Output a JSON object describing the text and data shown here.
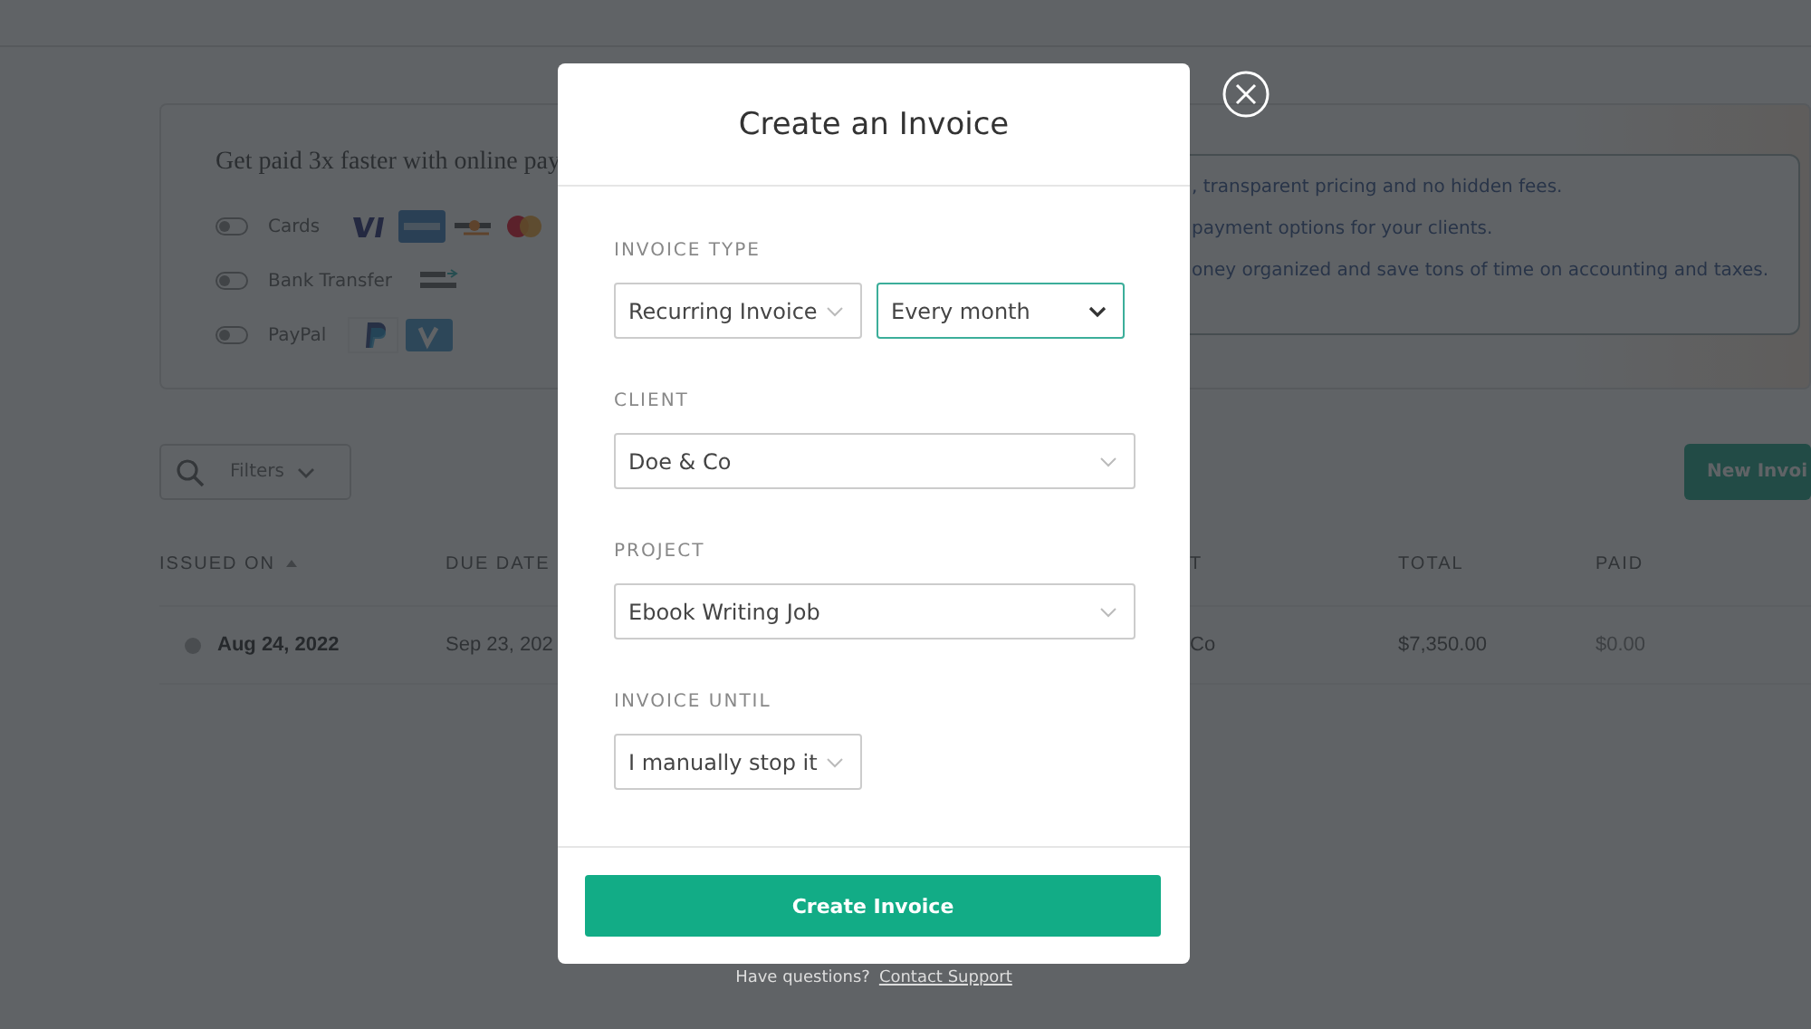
{
  "payments_card": {
    "headline": "Get paid 3x faster with online pay",
    "methods": [
      {
        "label": "Cards",
        "on": false,
        "kind": "cards"
      },
      {
        "label": "Bank Transfer",
        "on": false,
        "kind": "bank"
      },
      {
        "label": "PayPal",
        "on": false,
        "kind": "paypal"
      }
    ],
    "benefits": [
      ", transparent pricing and no hidden fees.",
      "payment options for your clients.",
      "oney organized and save tons of time on accounting and taxes."
    ]
  },
  "toolbar": {
    "filters": "Filters",
    "new_invoice": "New Invoi"
  },
  "table": {
    "columns": [
      {
        "label": "ISSUED ON",
        "sorted": true
      },
      {
        "label": "DUE DATE",
        "sorted": false
      },
      {
        "label": "T",
        "sorted": false
      },
      {
        "label": "TOTAL",
        "sorted": false
      },
      {
        "label": "PAID",
        "sorted": false
      }
    ],
    "rows": [
      {
        "cells": [
          "Aug 24, 2022",
          "Sep 23, 202",
          "Co",
          "$7,350.00",
          "$0.00"
        ]
      }
    ]
  },
  "modal": {
    "title": "Create an Invoice",
    "fields": [
      {
        "label": "INVOICE TYPE",
        "selects": [
          {
            "value": "Recurring Invoice",
            "focused": false,
            "wide": false
          },
          {
            "value": "Every month",
            "focused": true,
            "wide": false
          }
        ]
      },
      {
        "label": "CLIENT",
        "selects": [
          {
            "value": "Doe & Co",
            "focused": false,
            "wide": true
          }
        ]
      },
      {
        "label": "PROJECT",
        "selects": [
          {
            "value": "Ebook Writing Job",
            "focused": false,
            "wide": true
          }
        ]
      },
      {
        "label": "INVOICE UNTIL",
        "selects": [
          {
            "value": "I manually stop it",
            "focused": false,
            "wide": false
          }
        ]
      }
    ],
    "submit": "Create Invoice"
  },
  "help": {
    "text": "Have questions?",
    "link": "Contact Support"
  }
}
